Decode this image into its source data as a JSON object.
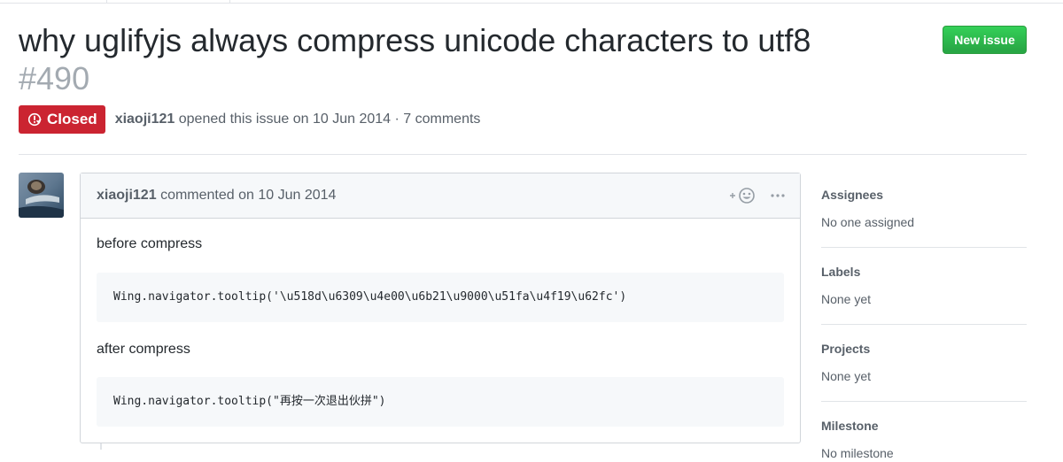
{
  "issue": {
    "title": "why uglifyjs always compress unicode characters to utf8",
    "number": "#490",
    "state": "Closed",
    "author": "xiaoji121",
    "opened_text": "opened this issue on 10 Jun 2014 · 7 comments"
  },
  "header": {
    "new_issue_label": "New issue"
  },
  "comment": {
    "author": "xiaoji121",
    "commented_text": "commented on 10 Jun 2014",
    "reaction_icon": "smiley-add-icon",
    "more_icon": "kebab-horizontal-icon",
    "paragraph1": "before compress",
    "code1": "Wing.navigator.tooltip('\\u518d\\u6309\\u4e00\\u6b21\\u9000\\u51fa\\u4f19\\u62fc')",
    "paragraph2": "after compress",
    "code2": "Wing.navigator.tooltip(\"再按一次退出伙拼\")"
  },
  "sidebar": {
    "assignees_heading": "Assignees",
    "assignees_value": "No one assigned",
    "labels_heading": "Labels",
    "labels_value": "None yet",
    "projects_heading": "Projects",
    "projects_value": "None yet",
    "milestone_heading": "Milestone",
    "milestone_value": "No milestone"
  },
  "colors": {
    "closed_red": "#cb2431",
    "new_issue_green": "#28a745",
    "muted_text": "#586069",
    "border": "#d1d5da"
  }
}
